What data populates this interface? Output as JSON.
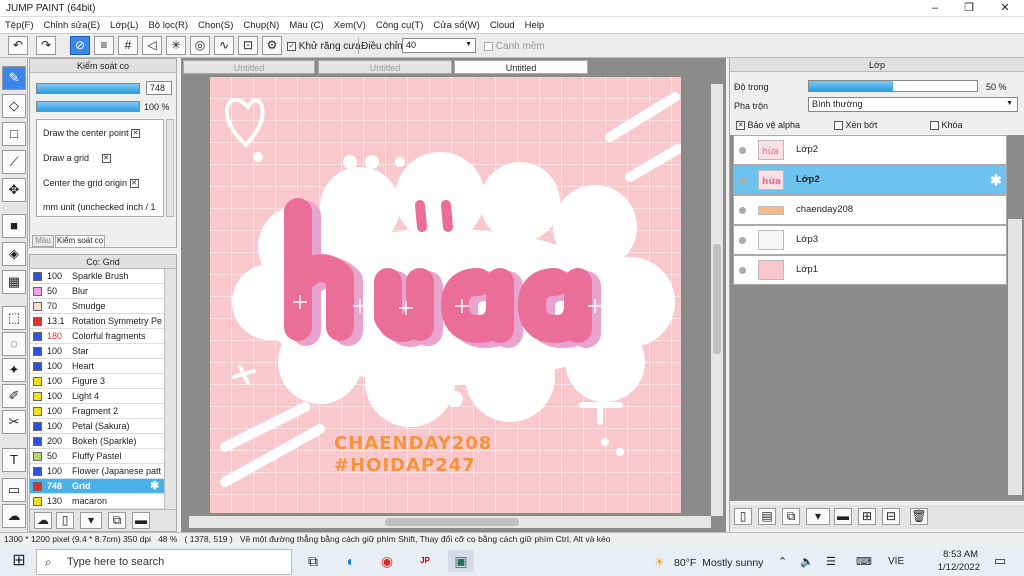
{
  "window": {
    "title": "JUMP PAINT (64bit)",
    "minimize": "–",
    "maximize": "❐",
    "close": "✕"
  },
  "menu": [
    "Tệp(F)",
    "Chỉnh sửa(E)",
    "Lớp(L)",
    "Bộ lọc(R)",
    "Chọn(S)",
    "Chụp(N)",
    "Màu (C)",
    "Xem(V)",
    "Công cụ(T)",
    "Cửa sổ(W)",
    "Cloud",
    "Help"
  ],
  "toolbar": {
    "antialias_label": "Khử răng cưa",
    "adjust_label": "Điều chỉnh",
    "adjust_value": "40",
    "snap_label": "Canh mềm"
  },
  "brush_control": {
    "title": "Kiểm soát cọ",
    "size_value": "748",
    "opacity_value": "100 %",
    "options": [
      "Draw the center point",
      "Draw a grid",
      "Center the grid origin",
      "mm unit (unchecked inch / 1"
    ],
    "tabs": [
      "Màu",
      "Kiểm soát cọ"
    ]
  },
  "brush_list": {
    "title": "Cọ: Grid",
    "items": [
      {
        "value": "100",
        "name": "Sparkle Brush",
        "color": "#3050e0"
      },
      {
        "value": "50",
        "name": "Blur",
        "color": "#f2a0e8"
      },
      {
        "value": "70",
        "name": "Smudge",
        "color": "#f8e0d0"
      },
      {
        "value": "13.1",
        "name": "Rotation Symmetry Pe",
        "color": "#e03030"
      },
      {
        "value": "180",
        "name": "Colorful fragments",
        "color": "#3050e0"
      },
      {
        "value": "100",
        "name": "Star",
        "color": "#3050e0"
      },
      {
        "value": "100",
        "name": "Heart",
        "color": "#3050e0"
      },
      {
        "value": "100",
        "name": "Figure 3",
        "color": "#f0e020"
      },
      {
        "value": "100",
        "name": "Light 4",
        "color": "#f0e020"
      },
      {
        "value": "100",
        "name": "Fragment 2",
        "color": "#f0e020"
      },
      {
        "value": "100",
        "name": "Petal (Sakura)",
        "color": "#3050e0"
      },
      {
        "value": "200",
        "name": "Bokeh (Sparkle)",
        "color": "#3050e0"
      },
      {
        "value": "50",
        "name": "Fluffy Pastel",
        "color": "#b0e060"
      },
      {
        "value": "100",
        "name": "Flower (Japanese patt",
        "color": "#3050e0"
      },
      {
        "value": "748",
        "name": "Grid",
        "color": "#e03030",
        "selected": true
      },
      {
        "value": "130",
        "name": "macaron",
        "color": "#f0e020"
      }
    ]
  },
  "tabs": [
    "Untitled",
    "Untitled",
    "Untitled"
  ],
  "artwork": {
    "word": "hừa",
    "credit1": "CHAENDAY208",
    "credit2": "#HOIDAP247"
  },
  "layer_panel": {
    "title": "Lớp",
    "opacity_label": "Độ trong",
    "opacity_value": "50 %",
    "opacity_fraction": 0.5,
    "blend_label": "Pha trộn",
    "blend_value": "Bình thường",
    "protect_alpha": "Bảo vệ alpha",
    "clip": "Xén bớt",
    "lock": "Khóa",
    "layers": [
      {
        "name": "Lớp2",
        "selected": false
      },
      {
        "name": "Lớp2",
        "selected": true
      },
      {
        "name": "chaenday208",
        "selected": false
      },
      {
        "name": "Lớp3",
        "selected": false
      },
      {
        "name": "Lớp1",
        "selected": false
      }
    ]
  },
  "status": {
    "size": "1300 * 1200 pixel  (9.4 * 8.7cm)  350 dpi",
    "zoom": "48 %",
    "coords": "( 1378, 519 )",
    "hint": "Vẽ một đường thẳng bằng cách giữ phím Shift, Thay đổi cỡ cọ bằng cách giữ phím Ctrl, Alt và kéo"
  },
  "taskbar": {
    "search_placeholder": "Type here to search",
    "weather_temp": "80°F",
    "weather_text": "Mostly sunny",
    "lang": "VIE",
    "time": "8:53 AM",
    "date": "1/12/2022"
  }
}
